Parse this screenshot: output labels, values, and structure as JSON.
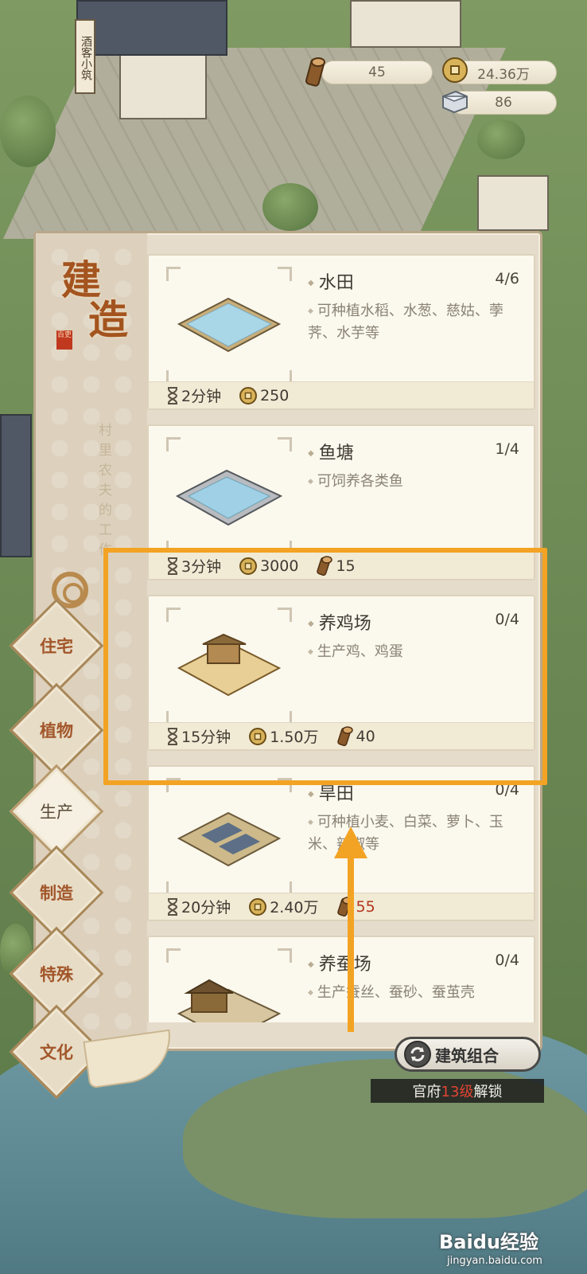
{
  "resources": {
    "wood": "45",
    "coins": "24.36万",
    "stone": "86"
  },
  "map": {
    "tavern_sign": "酒客小筑"
  },
  "panel": {
    "title_char1": "建",
    "title_char2": "造",
    "seal": "百吏",
    "description_vertical": "村里农夫的工作"
  },
  "categories": [
    {
      "label": "住宅",
      "active": false
    },
    {
      "label": "植物",
      "active": false
    },
    {
      "label": "生产",
      "active": true
    },
    {
      "label": "制造",
      "active": false
    },
    {
      "label": "特殊",
      "active": false
    },
    {
      "label": "文化",
      "active": false
    }
  ],
  "buildings": [
    {
      "name": "水田",
      "count": "4/6",
      "desc": "可种植水稻、水葱、慈姑、荸荠、水芋等",
      "time": "2分钟",
      "coins": "250",
      "wood": ""
    },
    {
      "name": "鱼塘",
      "count": "1/4",
      "desc": "可饲养各类鱼",
      "time": "3分钟",
      "coins": "3000",
      "wood": "15"
    },
    {
      "name": "养鸡场",
      "count": "0/4",
      "desc": "生产鸡、鸡蛋",
      "time": "15分钟",
      "coins": "1.50万",
      "wood": "40"
    },
    {
      "name": "旱田",
      "count": "0/4",
      "desc": "可种植小麦、白菜、萝卜、玉米、辣椒等",
      "time": "20分钟",
      "coins": "2.40万",
      "wood": "55"
    },
    {
      "name": "养蚕场",
      "count": "0/4",
      "desc": "生产蚕丝、蚕砂、蚕茧壳",
      "time": "",
      "coins": "",
      "wood": ""
    }
  ],
  "combo": {
    "label": "建筑组合",
    "unlock_prefix": "官府",
    "unlock_level": "13级",
    "unlock_suffix": "解锁"
  },
  "watermark": {
    "main": "Baidu经验",
    "sub": "jingyan.baidu.com"
  },
  "colors": {
    "highlight": "#f3a323",
    "insufficient": "#b2361c",
    "title": "#a4541f"
  }
}
